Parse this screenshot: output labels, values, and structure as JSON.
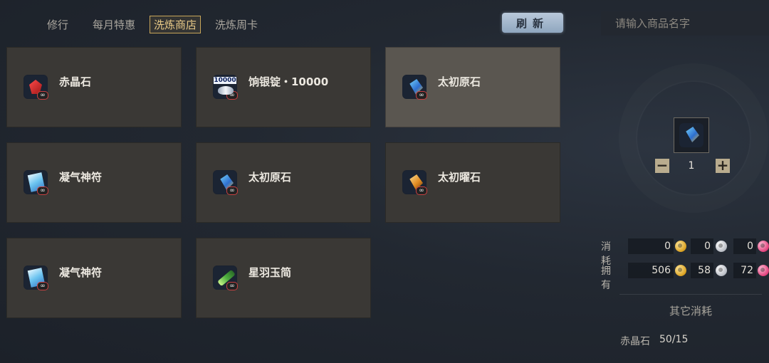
{
  "tabs": [
    {
      "label": "修行"
    },
    {
      "label": "每月特惠"
    },
    {
      "label": "洗炼商店"
    },
    {
      "label": "洗炼周卡"
    }
  ],
  "active_tab": "洗炼商店",
  "refresh_label": "刷新",
  "search": {
    "placeholder": "请输入商品名字"
  },
  "items": [
    {
      "name": "赤晶石",
      "icon": "red-crystal-icon",
      "badge": "∞"
    },
    {
      "name": "饷银锭・10000",
      "icon": "silver-ingot-icon",
      "icon_text": "10000",
      "badge": "∞"
    },
    {
      "name": "太初原石",
      "icon": "primordial-stone-icon",
      "badge": "∞",
      "selected": true
    },
    {
      "name": "凝气神符",
      "icon": "talisman-icon",
      "badge": "∞"
    },
    {
      "name": "太初原石",
      "icon": "primordial-stone-icon",
      "badge": "∞"
    },
    {
      "name": "太初曜石",
      "icon": "gold-stone-icon",
      "badge": "∞"
    },
    {
      "name": "凝气神符",
      "icon": "talisman-icon",
      "badge": "∞"
    },
    {
      "name": "星羽玉简",
      "icon": "jade-slip-icon",
      "badge": "∞"
    }
  ],
  "detail": {
    "selected_icon": "primordial-stone-icon",
    "quantity": "1",
    "minus": "−",
    "plus": "+",
    "consume_label": "消耗",
    "own_label": "拥有",
    "consume": [
      "0",
      "0",
      "0"
    ],
    "own": [
      "506",
      "58",
      "72"
    ],
    "currency_icons": [
      "gold-coin-icon",
      "silver-coin-icon",
      "pink-coin-icon"
    ],
    "other_title": "其它消耗",
    "requirement": {
      "name": "赤晶石",
      "count": "50/15"
    }
  },
  "colors": {
    "active_tab": "#e8c987",
    "card": "#3a3835",
    "card_selected": "#5a5650",
    "refresh": "#a9bccf"
  }
}
